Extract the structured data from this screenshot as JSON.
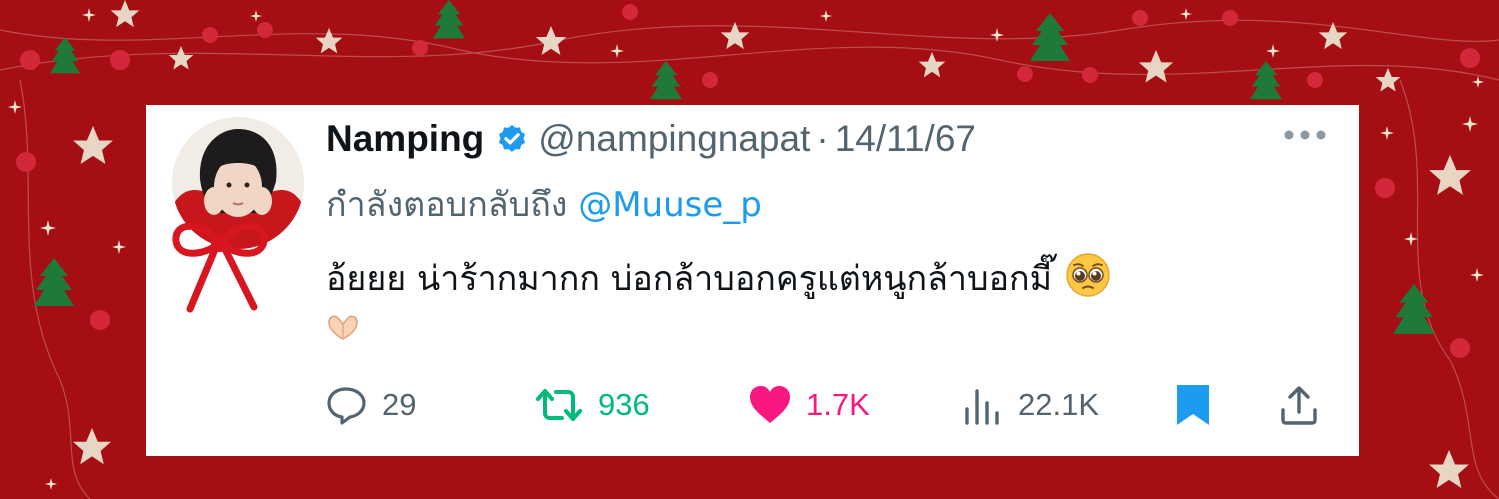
{
  "tweet": {
    "display_name": "Namping",
    "handle": "@nampingnapat",
    "separator": "·",
    "date": "14/11/67",
    "replying_to_prefix": "กำลังตอบกลับถึง",
    "replying_to_mention": "@Muuse_p",
    "text": "อ้ยยย น่าร้ากมากก บ่อกล้าบอกครูแต่หนูกล้าบอกมี๊",
    "trailing_emoji": "pleading-face-emoji",
    "second_line_emoji": "heart-hands-emoji"
  },
  "actions": {
    "replies": "29",
    "retweets": "936",
    "likes": "1.7K",
    "views": "22.1K"
  },
  "colors": {
    "background": "#a50e12",
    "name": "#0f1419",
    "muted": "#536471",
    "mention": "#1d9bf0",
    "retweet": "#00ba7c",
    "like": "#f91880",
    "bookmark": "#1d9bf0"
  }
}
